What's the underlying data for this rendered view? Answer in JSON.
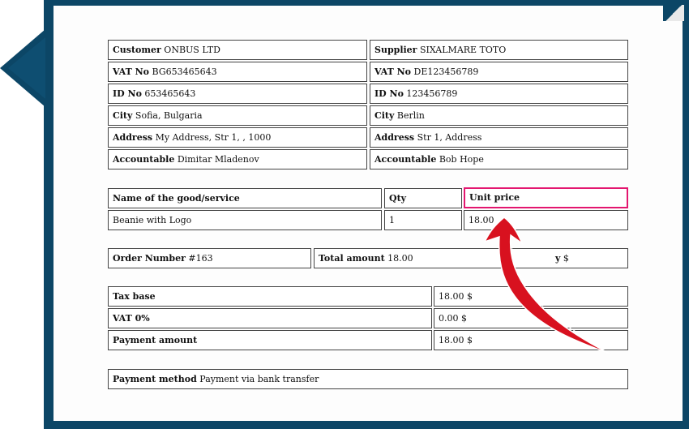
{
  "parties": {
    "customer_label": "Customer",
    "customer_value": "ONBUS LTD",
    "supplier_label": "Supplier",
    "supplier_value": "SIXALMARE TOTO",
    "c_vat_label": "VAT No",
    "c_vat_value": "BG653465643",
    "s_vat_label": "VAT No",
    "s_vat_value": "DE123456789",
    "c_id_label": "ID No",
    "c_id_value": "653465643",
    "s_id_label": "ID No",
    "s_id_value": "123456789",
    "c_city_label": "City",
    "c_city_value": "Sofia, Bulgaria",
    "s_city_label": "City",
    "s_city_value": "Berlin",
    "c_addr_label": "Address",
    "c_addr_value": "My Address, Str 1, , 1000",
    "s_addr_label": "Address",
    "s_addr_value": "Str 1, Address",
    "c_acc_label": "Accountable",
    "c_acc_value": "Dimitar Mladenov",
    "s_acc_label": "Accountable",
    "s_acc_value": "Bob Hope"
  },
  "items": {
    "headers": [
      "Name of the good/service",
      "Qty",
      "Unit price"
    ],
    "rows": [
      [
        "Beanie with Logo",
        "1",
        "18.00"
      ]
    ]
  },
  "order": {
    "number_label": "Order Number",
    "number_value": "#163",
    "total_label": "Total amount",
    "total_value": "18.00",
    "currency_partial": "y",
    "currency_value": "$"
  },
  "totals": {
    "tax_base_label": "Tax base",
    "tax_base_value": "18.00 $",
    "vat_label": "VAT 0%",
    "vat_value": "0.00 $",
    "payment_label": "Payment amount",
    "payment_value": "18.00 $"
  },
  "payment": {
    "method_label": "Payment method",
    "method_value": "Payment via bank transfer"
  },
  "colors": {
    "frame": "#0c4666",
    "highlight": "#e3166f",
    "arrow": "#d8111f"
  }
}
